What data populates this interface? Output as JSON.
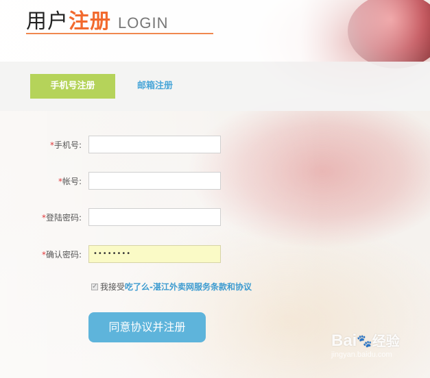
{
  "header": {
    "title_part1": "用户",
    "title_part2": "注册",
    "title_part3": "LOGIN"
  },
  "tabs": [
    {
      "label": "手机号注册",
      "active": true
    },
    {
      "label": "邮箱注册",
      "active": false
    }
  ],
  "form": {
    "phone": {
      "required_mark": "*",
      "label": "手机号:",
      "value": ""
    },
    "account": {
      "required_mark": "*",
      "label": "帐号:",
      "value": ""
    },
    "password": {
      "required_mark": "*",
      "label": "登陆密码:",
      "value": ""
    },
    "confirm": {
      "required_mark": "*",
      "label": "确认密码:",
      "value": "••••••••"
    }
  },
  "agreement": {
    "checked": true,
    "prefix": "我接受",
    "link": "吃了么-湛江外卖网服务条款和协议"
  },
  "submit_label": "同意协议并注册",
  "watermark": {
    "brand": "Bai",
    "brand2": "经验",
    "url": "jingyan.baidu.com"
  },
  "colors": {
    "accent_orange": "#f26a2e",
    "tab_active": "#b5d35a",
    "link_blue": "#3d9bd0",
    "button_blue": "#5eb4db",
    "required_red": "#e0393b"
  }
}
